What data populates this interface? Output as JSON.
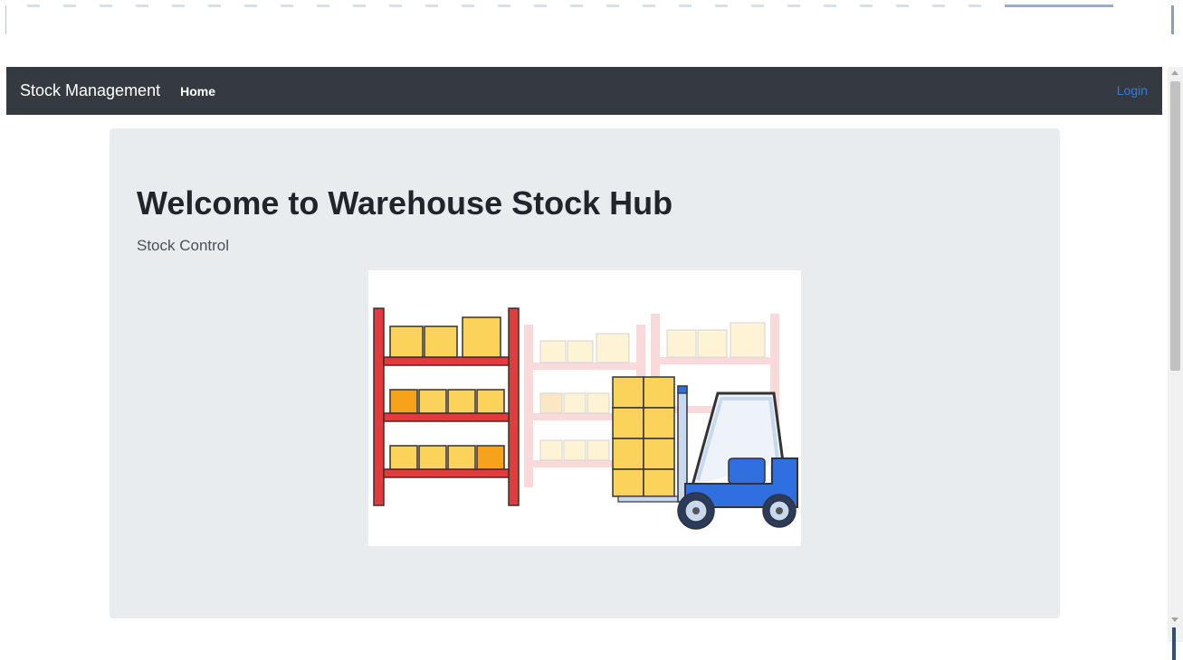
{
  "navbar": {
    "brand": "Stock Management",
    "home_label": "Home",
    "login_label": "Login"
  },
  "hero": {
    "title": "Welcome to Warehouse Stock Hub",
    "subtitle": "Stock Control"
  },
  "colors": {
    "navbar_bg": "#343a40",
    "jumbotron_bg": "#e9ecef",
    "link": "#2f7de1",
    "rack_red": "#e23b3b",
    "box_yellow": "#fcd35a",
    "box_orange": "#f6a21a",
    "forklift_blue": "#2f6fe0"
  },
  "icons": {
    "illustration": "warehouse-forklift-illustration"
  }
}
